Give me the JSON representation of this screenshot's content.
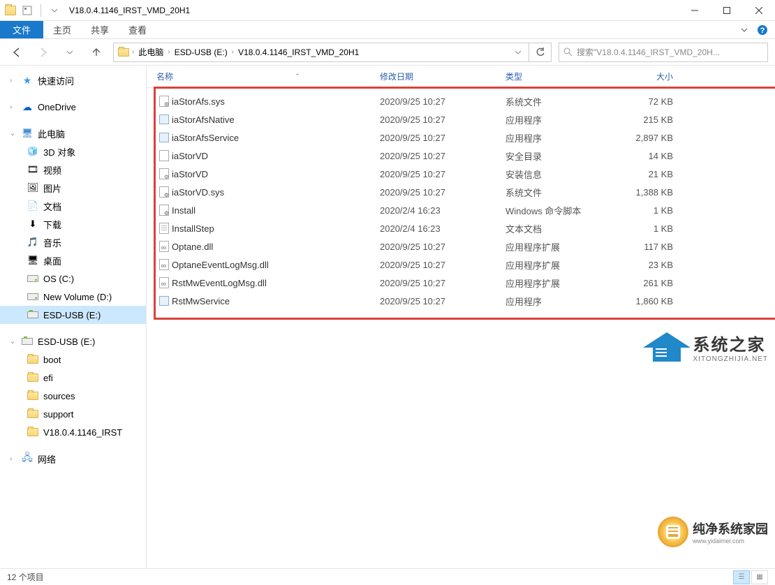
{
  "titlebar": {
    "title": "V18.0.4.1146_IRST_VMD_20H1"
  },
  "ribbon": {
    "file": "文件",
    "tabs": [
      "主页",
      "共享",
      "查看"
    ]
  },
  "breadcrumb": {
    "items": [
      "此电脑",
      "ESD-USB (E:)",
      "V18.0.4.1146_IRST_VMD_20H1"
    ]
  },
  "search": {
    "placeholder": "搜索\"V18.0.4.1146_IRST_VMD_20H..."
  },
  "sidebar": {
    "quickaccess": "快速访问",
    "onedrive": "OneDrive",
    "thispc": "此电脑",
    "pc_items": [
      "3D 对象",
      "视频",
      "图片",
      "文档",
      "下载",
      "音乐",
      "桌面",
      "OS (C:)",
      "New Volume (D:)",
      "ESD-USB (E:)"
    ],
    "esd": "ESD-USB (E:)",
    "esd_items": [
      "boot",
      "efi",
      "sources",
      "support",
      "V18.0.4.1146_IRST"
    ],
    "network": "网络"
  },
  "columns": {
    "name": "名称",
    "date": "修改日期",
    "type": "类型",
    "size": "大小"
  },
  "files": [
    {
      "name": "iaStorAfs.sys",
      "date": "2020/9/25 10:27",
      "type": "系统文件",
      "size": "72 KB",
      "icon": "sys"
    },
    {
      "name": "iaStorAfsNative",
      "date": "2020/9/25 10:27",
      "type": "应用程序",
      "size": "215 KB",
      "icon": "exe"
    },
    {
      "name": "iaStorAfsService",
      "date": "2020/9/25 10:27",
      "type": "应用程序",
      "size": "2,897 KB",
      "icon": "exe"
    },
    {
      "name": "iaStorVD",
      "date": "2020/9/25 10:27",
      "type": "安全目录",
      "size": "14 KB",
      "icon": "cat"
    },
    {
      "name": "iaStorVD",
      "date": "2020/9/25 10:27",
      "type": "安装信息",
      "size": "21 KB",
      "icon": "inf"
    },
    {
      "name": "iaStorVD.sys",
      "date": "2020/9/25 10:27",
      "type": "系统文件",
      "size": "1,388 KB",
      "icon": "sys"
    },
    {
      "name": "Install",
      "date": "2020/2/4 16:23",
      "type": "Windows 命令脚本",
      "size": "1 KB",
      "icon": "cmd"
    },
    {
      "name": "InstallStep",
      "date": "2020/2/4 16:23",
      "type": "文本文档",
      "size": "1 KB",
      "icon": "txt"
    },
    {
      "name": "Optane.dll",
      "date": "2020/9/25 10:27",
      "type": "应用程序扩展",
      "size": "117 KB",
      "icon": "dll"
    },
    {
      "name": "OptaneEventLogMsg.dll",
      "date": "2020/9/25 10:27",
      "type": "应用程序扩展",
      "size": "23 KB",
      "icon": "dll"
    },
    {
      "name": "RstMwEventLogMsg.dll",
      "date": "2020/9/25 10:27",
      "type": "应用程序扩展",
      "size": "261 KB",
      "icon": "dll"
    },
    {
      "name": "RstMwService",
      "date": "2020/9/25 10:27",
      "type": "应用程序",
      "size": "1,860 KB",
      "icon": "exe"
    }
  ],
  "status": {
    "count": "12 个项目"
  },
  "watermark1": {
    "zh": "系统之家",
    "en": "XITONGZHIJIA.NET"
  },
  "watermark2": {
    "zh": "纯净系统家园",
    "en": "www.yidaimei.com"
  }
}
